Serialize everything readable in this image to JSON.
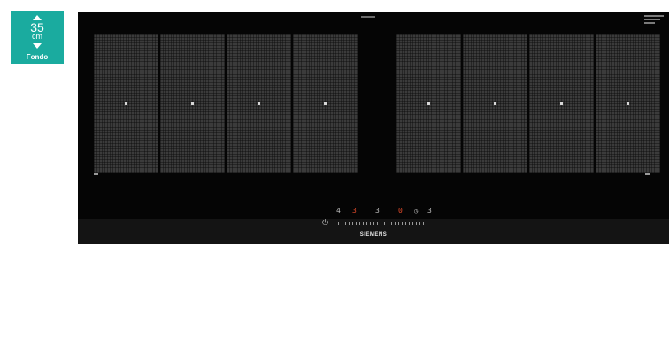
{
  "depth_selector": {
    "value": "35",
    "unit": "cm",
    "label": "Fondo"
  },
  "cooktop": {
    "brand": "SIEMENS",
    "zones": [
      "zone-1",
      "zone-2",
      "zone-3",
      "zone-4",
      "zone-5",
      "zone-6",
      "zone-7",
      "zone-8"
    ],
    "controls": {
      "power_symbol": "⏻",
      "level_1": "4",
      "level_2": "3",
      "level_3": "3",
      "level_4": "0",
      "level_5": "3"
    }
  },
  "colors": {
    "badge": "#1aab9f",
    "glass": "#050505",
    "zone": "#3b3b3b",
    "display_red": "#e04a2a"
  },
  "icons": [
    "arrow-up-icon",
    "arrow-down-icon",
    "power-icon",
    "timer-icon"
  ]
}
